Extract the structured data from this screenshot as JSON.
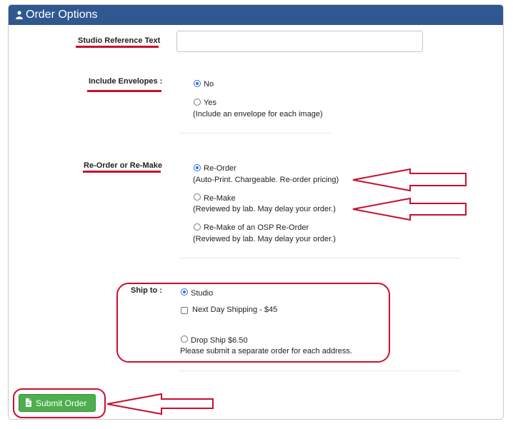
{
  "panel": {
    "title": "Order Options"
  },
  "fields": {
    "studio_reference": {
      "label": "Studio Reference Text",
      "value": "",
      "placeholder": ""
    },
    "include_envelopes": {
      "label": "Include Envelopes :",
      "options": [
        {
          "label": "No",
          "selected": true,
          "note": ""
        },
        {
          "label": "Yes",
          "selected": false,
          "note": "(Include an envelope for each image)"
        }
      ]
    },
    "reorder_remake": {
      "label": "Re-Order or Re-Make",
      "options": [
        {
          "label": "Re-Order",
          "selected": true,
          "note": "(Auto-Print. Chargeable. Re-order pricing)"
        },
        {
          "label": "Re-Make",
          "selected": false,
          "note": "(Reviewed by lab. May delay your order.)"
        },
        {
          "label": "Re-Make of an OSP Re-Order",
          "selected": false,
          "note": "(Reviewed by lab. May delay your order.)"
        }
      ]
    },
    "ship_to": {
      "label": "Ship to :",
      "studio": {
        "label": "Studio",
        "selected": true
      },
      "next_day": {
        "label": "Next Day Shipping - $45",
        "checked": false
      },
      "drop_ship": {
        "label": "Drop Ship $6.50",
        "selected": false,
        "note": "Please submit a separate order for each address."
      }
    }
  },
  "actions": {
    "submit_label": "Submit Order"
  },
  "colors": {
    "header": "#30578f",
    "submit": "#4cae4c",
    "annotation": "#c8102e",
    "radio_selected": "#2e6ee0"
  },
  "icons": {
    "header": "user-icon",
    "submit": "document-icon"
  }
}
